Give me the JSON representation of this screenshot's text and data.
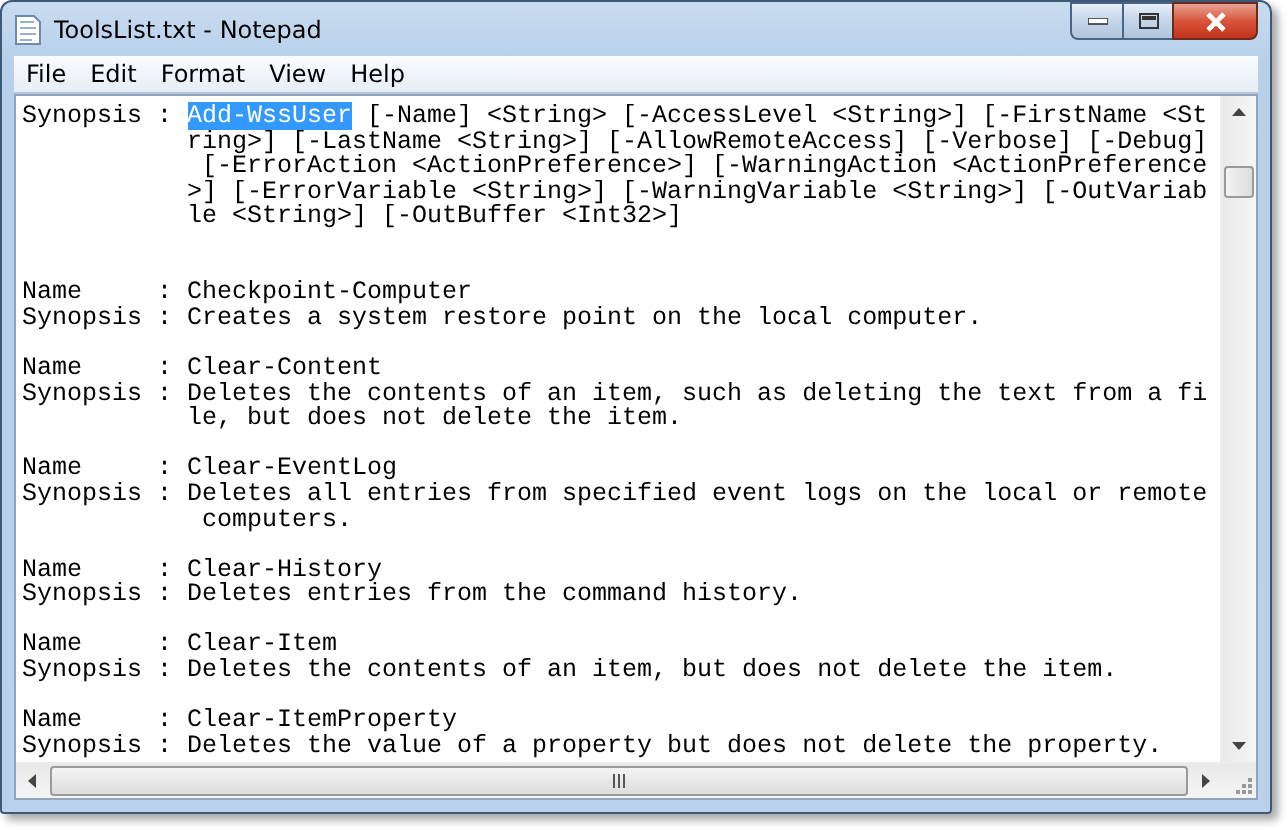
{
  "window": {
    "title": "ToolsList.txt - Notepad"
  },
  "menu": [
    "File",
    "Edit",
    "Format",
    "View",
    "Help"
  ],
  "document": {
    "blocks": [
      {
        "lines": [
          [
            {
              "text": "Synopsis : ",
              "selected": false
            },
            {
              "text": "Add-WssUser",
              "selected": true
            },
            {
              "text": " [-Name] <String> [-AccessLevel <String>] [-FirstName <St",
              "selected": false
            }
          ],
          "           ring>] [-LastName <String>] [-AllowRemoteAccess] [-Verbose] [-Debug]",
          "            [-ErrorAction <ActionPreference>] [-WarningAction <ActionPreference",
          "           >] [-ErrorVariable <String>] [-WarningVariable <String>] [-OutVariab",
          "           le <String>] [-OutBuffer <Int32>]"
        ]
      },
      {
        "lines": [
          "Name     : Checkpoint-Computer",
          "Synopsis : Creates a system restore point on the local computer."
        ]
      },
      {
        "lines": [
          "Name     : Clear-Content",
          "Synopsis : Deletes the contents of an item, such as deleting the text from a fi",
          "           le, but does not delete the item."
        ]
      },
      {
        "lines": [
          "Name     : Clear-EventLog",
          "Synopsis : Deletes all entries from specified event logs on the local or remote",
          "            computers."
        ]
      },
      {
        "lines": [
          "Name     : Clear-History",
          "Synopsis : Deletes entries from the command history."
        ]
      },
      {
        "lines": [
          "Name     : Clear-Item",
          "Synopsis : Deletes the contents of an item, but does not delete the item."
        ]
      },
      {
        "lines": [
          "Name     : Clear-ItemProperty",
          "Synopsis : Deletes the value of a property but does not delete the property."
        ]
      }
    ]
  }
}
